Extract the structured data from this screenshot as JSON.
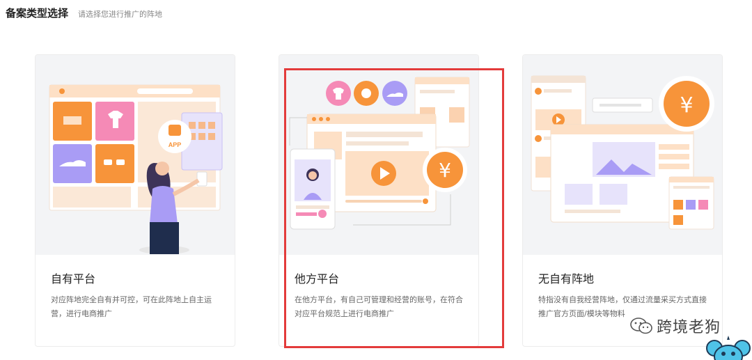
{
  "header": {
    "title": "备案类型选择",
    "subtitle": "请选择您进行推广的阵地"
  },
  "cards": [
    {
      "title": "自有平台",
      "description": "对应阵地完全自有并可控，可在此阵地上自主运营，进行电商推广",
      "badge": "APP"
    },
    {
      "title": "他方平台",
      "description": "在他方平台，有自己可管理和经营的账号，在符合对应平台规范上进行电商推广",
      "currency_symbol": "¥"
    },
    {
      "title": "无自有阵地",
      "description": "特指没有自我经营阵地，仅通过流量采买方式直接推广官方页面/模块等物料",
      "currency_symbol": "¥"
    }
  ],
  "watermark": {
    "text": "跨境老狗"
  },
  "colors": {
    "accent_orange": "#f7943a",
    "soft_peach": "#fde0c6",
    "purple": "#a99cf5",
    "pink": "#f58ab6",
    "highlight_red": "#e33b3b"
  }
}
